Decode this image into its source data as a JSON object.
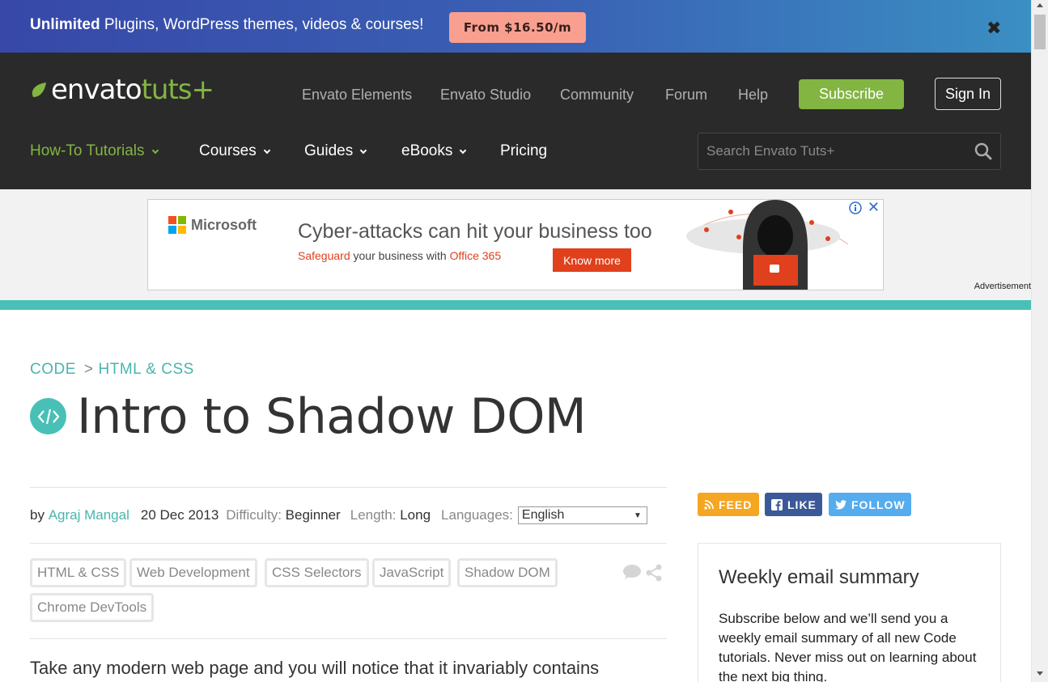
{
  "promo": {
    "bold": "Unlimited",
    "text": " Plugins, WordPress themes, videos & courses!",
    "button": "From $16.50/m",
    "close": "✖"
  },
  "header": {
    "logo_main": "envato",
    "logo_tuts": "tuts+",
    "top_links": [
      "Envato Elements",
      "Envato Studio",
      "Community",
      "Forum",
      "Help"
    ],
    "subscribe": "Subscribe",
    "signin": "Sign In",
    "main_nav": [
      {
        "label": "How-To Tutorials",
        "dropdown": true,
        "active": true
      },
      {
        "label": "Courses",
        "dropdown": true
      },
      {
        "label": "Guides",
        "dropdown": true
      },
      {
        "label": "eBooks",
        "dropdown": true
      },
      {
        "label": "Pricing",
        "dropdown": false
      }
    ],
    "search_placeholder": "Search Envato Tuts+"
  },
  "ad": {
    "brand": "Microsoft",
    "headline": "Cyber-attacks can hit your business too",
    "sub_red1": "Safeguard",
    "sub_mid": " your business with ",
    "sub_red2": "Office 365",
    "button": "Know more",
    "label": "Advertisement",
    "close": "✕"
  },
  "article": {
    "breadcrumb": [
      "CODE",
      "HTML & CSS"
    ],
    "breadcrumb_sep": ">",
    "title": "Intro to Shadow DOM",
    "by": "by",
    "author": "Agraj Mangal",
    "date": "20 Dec 2013",
    "difficulty_label": "Difficulty:",
    "difficulty": "Beginner",
    "length_label": "Length:",
    "length": "Long",
    "languages_label": "Languages:",
    "language": "English",
    "tags": [
      "HTML & CSS",
      "Web Development",
      "CSS Selectors",
      "JavaScript",
      "Shadow DOM",
      "Chrome DevTools"
    ],
    "intro": "Take any modern web page and you will notice that it invariably contains"
  },
  "sidebar": {
    "feed": "FEED",
    "like": "LIKE",
    "follow": "FOLLOW",
    "box_title": "Weekly email summary",
    "box_text": "Subscribe below and we’ll send you a weekly email summary of all new Code tutorials. Never miss out on learning about the next big thing."
  },
  "colors": {
    "accent_green": "#82b541",
    "teal": "#49c0b6",
    "header_bg": "#2a2a2a",
    "feed": "#f5a623",
    "like": "#3b5998",
    "follow": "#55acee"
  }
}
